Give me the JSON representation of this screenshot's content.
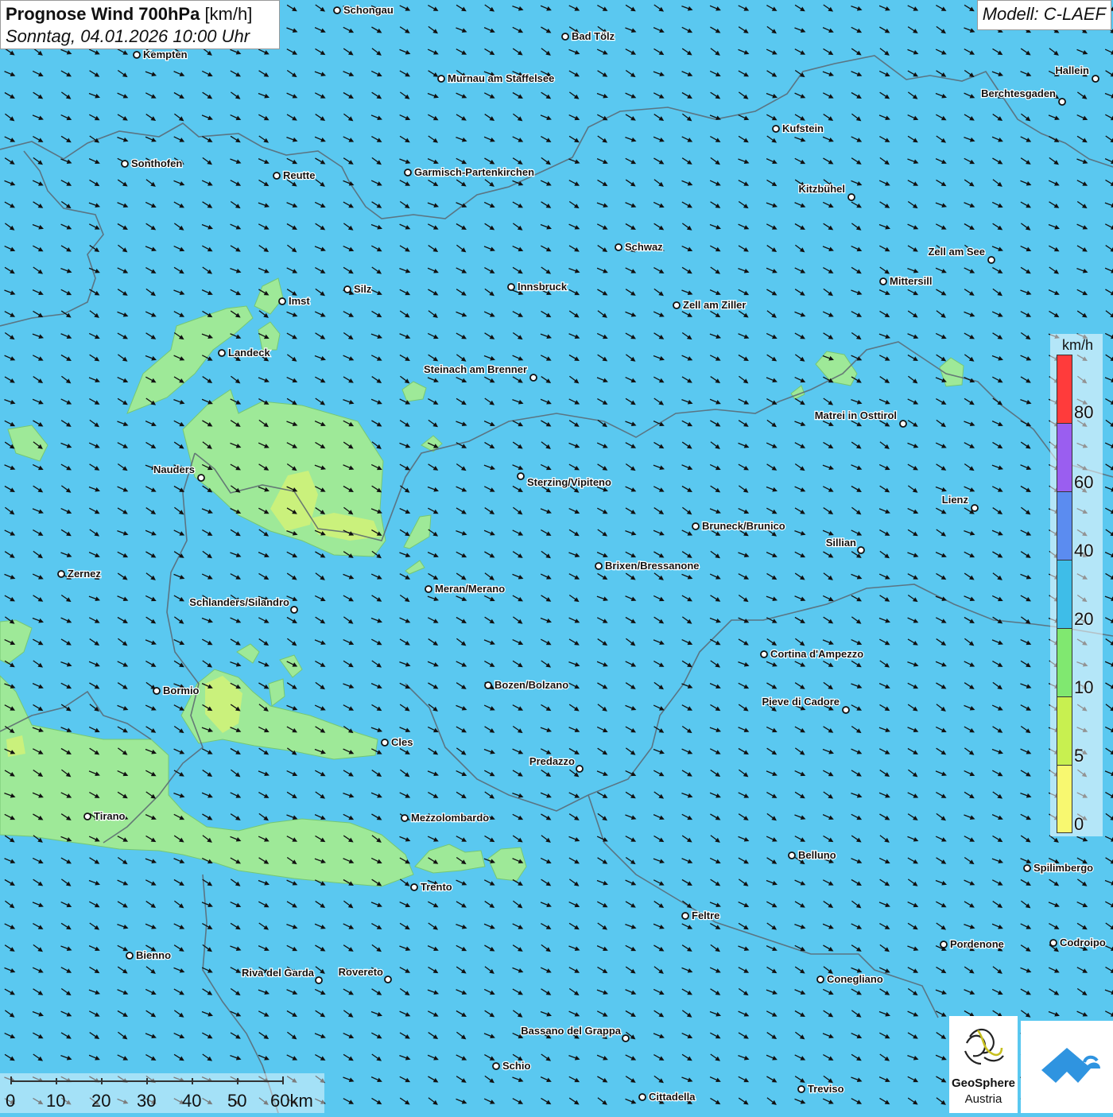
{
  "header": {
    "title_bold": "Prognose Wind 700hPa",
    "title_unit": "[km/h]",
    "datetime": "Sonntag, 04.01.2026 10:00 Uhr",
    "model": "Modell: C-LAEF"
  },
  "legend": {
    "unit": "km/h",
    "ticks": [
      "80",
      "60",
      "40",
      "20",
      "10",
      "5",
      "0"
    ],
    "colors": [
      "#ff3b3b",
      "#9a5ef0",
      "#5b8cf0",
      "#3ebde8",
      "#80e870",
      "#c8f050",
      "#f8f870"
    ]
  },
  "scale_bar": {
    "labels": [
      "0",
      "10",
      "20",
      "30",
      "40",
      "50",
      "60km"
    ]
  },
  "cities": [
    {
      "name": "Schongau"
    },
    {
      "name": "Bad Tölz"
    },
    {
      "name": "Kempten"
    },
    {
      "name": "Murnau am Staffelsee"
    },
    {
      "name": "Hallein"
    },
    {
      "name": "Berchtesgaden"
    },
    {
      "name": "Kufstein"
    },
    {
      "name": "Sonthofen"
    },
    {
      "name": "Reutte"
    },
    {
      "name": "Garmisch-Partenkirchen"
    },
    {
      "name": "Kitzbühel"
    },
    {
      "name": "Schwaz"
    },
    {
      "name": "Zell am See"
    },
    {
      "name": "Mittersill"
    },
    {
      "name": "Imst"
    },
    {
      "name": "Silz"
    },
    {
      "name": "Innsbruck"
    },
    {
      "name": "Zell am Ziller"
    },
    {
      "name": "Landeck"
    },
    {
      "name": "Steinach am Brenner"
    },
    {
      "name": "Matrei in Osttirol"
    },
    {
      "name": "Nauders"
    },
    {
      "name": "Sterzing/Vipiteno"
    },
    {
      "name": "Lienz"
    },
    {
      "name": "Bruneck/Brunico"
    },
    {
      "name": "Sillian"
    },
    {
      "name": "Brixen/Bressanone"
    },
    {
      "name": "Zernez"
    },
    {
      "name": "Meran/Merano"
    },
    {
      "name": "Schlanders/Silandro"
    },
    {
      "name": "Cortina d'Ampezzo"
    },
    {
      "name": "Bozen/Bolzano"
    },
    {
      "name": "Bormio"
    },
    {
      "name": "Pieve di Cadore"
    },
    {
      "name": "Cles"
    },
    {
      "name": "Predazzo"
    },
    {
      "name": "Tirano"
    },
    {
      "name": "Mezzolombardo"
    },
    {
      "name": "Belluno"
    },
    {
      "name": "Spilimbergo"
    },
    {
      "name": "Trento"
    },
    {
      "name": "Feltre"
    },
    {
      "name": "Pordenone"
    },
    {
      "name": "Codroipo"
    },
    {
      "name": "Bienno"
    },
    {
      "name": "Riva del Garda"
    },
    {
      "name": "Rovereto"
    },
    {
      "name": "Conegliano"
    },
    {
      "name": "Bassano del Grappa"
    },
    {
      "name": "Schio"
    },
    {
      "name": "Treviso"
    },
    {
      "name": "Cittadella"
    }
  ],
  "logos": {
    "geosphere_line1": "GeoSphere",
    "geosphere_line2": "Austria"
  }
}
